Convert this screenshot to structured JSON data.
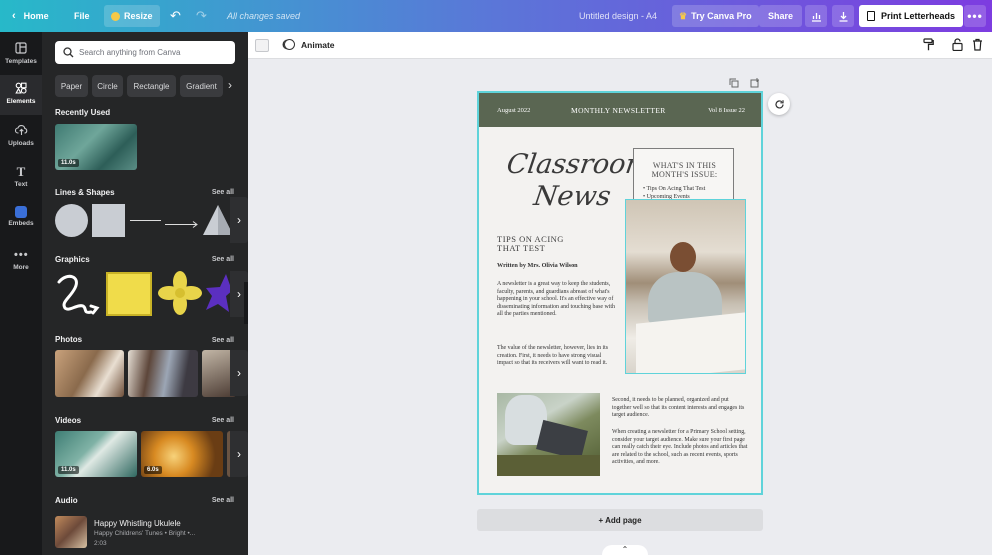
{
  "topbar": {
    "home_label": "Home",
    "file_label": "File",
    "resize_label": "Resize",
    "save_status": "All changes saved",
    "design_title": "Untitled design - A4",
    "try_pro_label": "Try Canva Pro",
    "share_label": "Share",
    "print_label": "Print Letterheads"
  },
  "rail": {
    "items": [
      {
        "label": "Templates",
        "icon": "templates-icon"
      },
      {
        "label": "Elements",
        "icon": "elements-icon"
      },
      {
        "label": "Uploads",
        "icon": "upload-icon"
      },
      {
        "label": "Text",
        "icon": "text-icon"
      },
      {
        "label": "Embeds",
        "icon": "embeds-icon"
      },
      {
        "label": "More",
        "icon": "more-icon"
      }
    ]
  },
  "panel": {
    "search_placeholder": "Search anything from Canva",
    "chips": [
      "Paper",
      "Circle",
      "Rectangle",
      "Gradient"
    ],
    "recently_used": {
      "title": "Recently Used",
      "duration": "11.0s"
    },
    "lines_shapes": {
      "title": "Lines & Shapes",
      "see_all": "See all"
    },
    "graphics": {
      "title": "Graphics",
      "see_all": "See all"
    },
    "photos": {
      "title": "Photos",
      "see_all": "See all"
    },
    "videos": {
      "title": "Videos",
      "see_all": "See all",
      "durations": [
        "11.0s",
        "6.0s"
      ]
    },
    "audio": {
      "title": "Audio",
      "see_all": "See all",
      "track_title": "Happy Whistling Ukulele",
      "track_meta": "Happy Childrens' Tunes • Bright •...",
      "track_duration": "2:03"
    }
  },
  "toolbar": {
    "animate_label": "Animate"
  },
  "newsletter": {
    "date": "August 2022",
    "header_title": "MONTHLY NEWSLETTER",
    "issue": "Vol 8 Issue 22",
    "script_line1": "Classroom",
    "script_line2": "News",
    "box_title": "WHAT'S IN THIS MONTH'S ISSUE:",
    "box_items": [
      "Tips On Acing That Test",
      "Upcoming Events"
    ],
    "article_title": "TIPS ON ACING THAT TEST",
    "byline": "Written by Mrs. Olivia Wilson",
    "para1": "A newsletter is a great way to keep the students, faculty, parents, and guardians abreast of what's happening in your school. It's an effective way of disseminating information and touching base with all the parties mentioned.",
    "para2": "The value of the newsletter, however, lies in its creation. First, it needs to have strong visual impact so that its receivers will want to read it.",
    "para3": "Second, it needs to be planned, organized and put together well so that its content interests and engages its target audience.",
    "para4": "When creating a newsletter for a Primary School setting, consider your target audience. Make sure your first page can really catch their eye. Include photos and articles that are related to the school, such as recent events, sports activities, and more."
  },
  "canvas": {
    "add_page_label": "+ Add page"
  },
  "colors": {
    "header_green": "#5a6652",
    "selection": "#5fd3da",
    "panel_bg": "#252627",
    "rail_bg": "#18191b"
  }
}
